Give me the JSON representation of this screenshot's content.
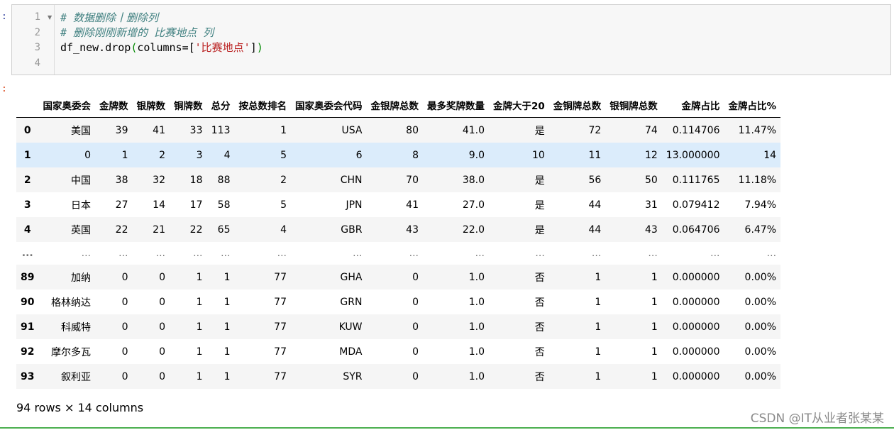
{
  "prompts": {
    "input": ":",
    "output": ":"
  },
  "code": {
    "line_numbers": [
      "1",
      "2",
      "3",
      "4"
    ],
    "line1_comment": "# 数据删除丨删除列",
    "line2_comment": "# 删除刚刚新增的 比赛地点 列",
    "line3_prefix": "df_new.drop",
    "line3_open": "(",
    "line3_mid": "columns=[",
    "line3_str": "'比赛地点'",
    "line3_close_bracket": "]",
    "line3_close": ")"
  },
  "table": {
    "columns": [
      "国家奥委会",
      "金牌数",
      "银牌数",
      "铜牌数",
      "总分",
      "按总数排名",
      "国家奥委会代码",
      "金银牌总数",
      "最多奖牌数量",
      "金牌大于20",
      "金铜牌总数",
      "银铜牌总数",
      "金牌占比",
      "金牌占比%"
    ],
    "rows": [
      {
        "index": "0",
        "cells": [
          "美国",
          "39",
          "41",
          "33",
          "113",
          "1",
          "USA",
          "80",
          "41.0",
          "是",
          "72",
          "74",
          "0.114706",
          "11.47%"
        ]
      },
      {
        "index": "1",
        "cells": [
          "0",
          "1",
          "2",
          "3",
          "4",
          "5",
          "6",
          "8",
          "9.0",
          "10",
          "11",
          "12",
          "13.000000",
          "14"
        ]
      },
      {
        "index": "2",
        "cells": [
          "中国",
          "38",
          "32",
          "18",
          "88",
          "2",
          "CHN",
          "70",
          "38.0",
          "是",
          "56",
          "50",
          "0.111765",
          "11.18%"
        ]
      },
      {
        "index": "3",
        "cells": [
          "日本",
          "27",
          "14",
          "17",
          "58",
          "5",
          "JPN",
          "41",
          "27.0",
          "是",
          "44",
          "31",
          "0.079412",
          "7.94%"
        ]
      },
      {
        "index": "4",
        "cells": [
          "英国",
          "22",
          "21",
          "22",
          "65",
          "4",
          "GBR",
          "43",
          "22.0",
          "是",
          "44",
          "43",
          "0.064706",
          "6.47%"
        ]
      },
      {
        "index": "...",
        "cells": [
          "...",
          "...",
          "...",
          "...",
          "...",
          "...",
          "...",
          "...",
          "...",
          "...",
          "...",
          "...",
          "...",
          "..."
        ]
      },
      {
        "index": "89",
        "cells": [
          "加纳",
          "0",
          "0",
          "1",
          "1",
          "77",
          "GHA",
          "0",
          "1.0",
          "否",
          "1",
          "1",
          "0.000000",
          "0.00%"
        ]
      },
      {
        "index": "90",
        "cells": [
          "格林纳达",
          "0",
          "0",
          "1",
          "1",
          "77",
          "GRN",
          "0",
          "1.0",
          "否",
          "1",
          "1",
          "0.000000",
          "0.00%"
        ]
      },
      {
        "index": "91",
        "cells": [
          "科威特",
          "0",
          "0",
          "1",
          "1",
          "77",
          "KUW",
          "0",
          "1.0",
          "否",
          "1",
          "1",
          "0.000000",
          "0.00%"
        ]
      },
      {
        "index": "92",
        "cells": [
          "摩尔多瓦",
          "0",
          "0",
          "1",
          "1",
          "77",
          "MDA",
          "0",
          "1.0",
          "否",
          "1",
          "1",
          "0.000000",
          "0.00%"
        ]
      },
      {
        "index": "93",
        "cells": [
          "叙利亚",
          "0",
          "0",
          "1",
          "1",
          "77",
          "SYR",
          "0",
          "1.0",
          "否",
          "1",
          "1",
          "0.000000",
          "0.00%"
        ]
      }
    ],
    "hovered_row": "1",
    "shape_text": "94 rows × 14 columns"
  },
  "watermark": "CSDN @IT从业者张某某",
  "colors": {
    "hover_row": "#dbecfb",
    "stripe_row": "#f5f5f5",
    "cell_border_active": "#4caf50"
  }
}
